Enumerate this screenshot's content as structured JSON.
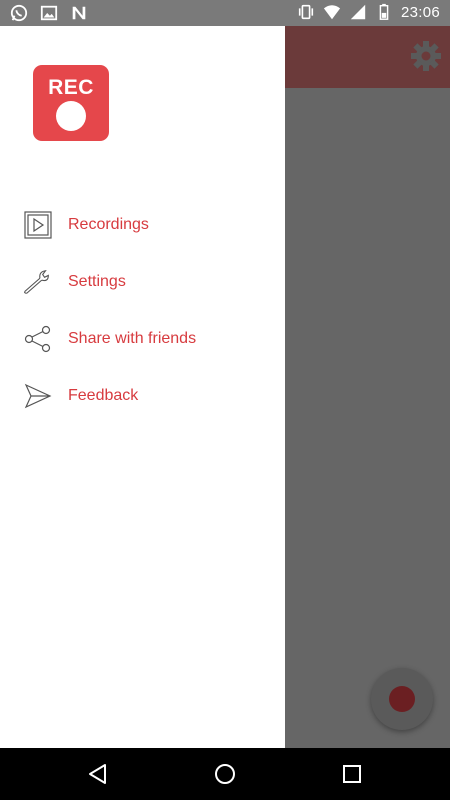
{
  "status_bar": {
    "time": "23:06",
    "left_icons": [
      "whatsapp-icon",
      "image-icon",
      "n-icon"
    ],
    "right_icons": [
      "vibrate-icon",
      "wifi-icon",
      "signal-icon",
      "battery-icon"
    ]
  },
  "drawer": {
    "logo": {
      "text": "REC"
    },
    "menu": [
      {
        "label": "Recordings",
        "icon": "play-box-icon"
      },
      {
        "label": "Settings",
        "icon": "wrench-icon"
      },
      {
        "label": "Share with friends",
        "icon": "share-icon"
      },
      {
        "label": "Feedback",
        "icon": "send-icon"
      }
    ]
  },
  "colors": {
    "accent": "#e5474b",
    "menu_text": "#d73b3f",
    "scrim": "#666666"
  },
  "nav_bar": {
    "buttons": [
      "back-icon",
      "home-icon",
      "recents-icon"
    ]
  }
}
